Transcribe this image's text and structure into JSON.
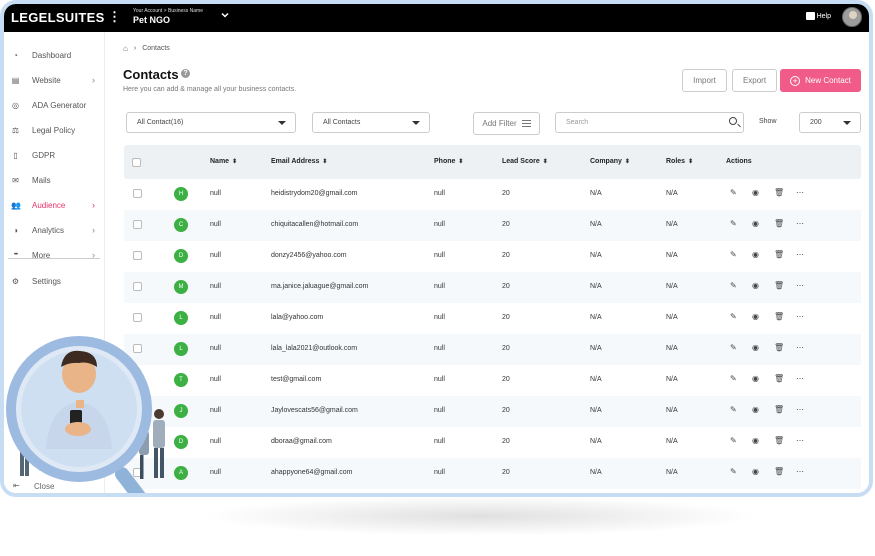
{
  "topbar": {
    "logo": "LEGELSUITES",
    "account_sub": "Your Account > Business Name",
    "account_name": "Pet NGO",
    "help_label": "Help"
  },
  "sidebar": {
    "items": [
      {
        "label": "Dashboard",
        "icon": "dashboard-icon",
        "chevron": false,
        "active": false
      },
      {
        "label": "Website",
        "icon": "website-icon",
        "chevron": true,
        "active": false
      },
      {
        "label": "ADA Generator",
        "icon": "ada-icon",
        "chevron": false,
        "active": false
      },
      {
        "label": "Legal Policy",
        "icon": "policy-icon",
        "chevron": false,
        "active": false
      },
      {
        "label": "GDPR",
        "icon": "gdpr-icon",
        "chevron": false,
        "active": false
      },
      {
        "label": "Mails",
        "icon": "mail-icon",
        "chevron": false,
        "active": false
      },
      {
        "label": "Audience",
        "icon": "audience-icon",
        "chevron": true,
        "active": true
      },
      {
        "label": "Analytics",
        "icon": "analytics-icon",
        "chevron": true,
        "active": false
      },
      {
        "label": "More",
        "icon": "more-icon",
        "chevron": true,
        "active": false
      },
      {
        "label": "Settings",
        "icon": "gear-icon",
        "chevron": false,
        "active": false
      }
    ],
    "close_label": "Close"
  },
  "breadcrumb": {
    "current": "Contacts"
  },
  "page": {
    "title": "Contacts",
    "subtitle": "Here you can add & manage all your business contacts.",
    "import_label": "Import",
    "export_label": "Export",
    "new_contact_label": "New Contact"
  },
  "filters": {
    "contact_select": "All Contact(16)",
    "list_select": "All Contacts",
    "add_filter_label": "Add Filter",
    "search_placeholder": "Search",
    "show_label": "Show",
    "show_value": "200"
  },
  "table": {
    "headers": {
      "name": "Name",
      "email": "Email Address",
      "phone": "Phone",
      "lead_score": "Lead Score",
      "company": "Company",
      "roles": "Roles",
      "actions": "Actions"
    },
    "rows": [
      {
        "initial": "H",
        "name": "null",
        "email": "heidistrydom20@gmail.com",
        "phone": "null",
        "lead_score": "20",
        "company": "N/A",
        "roles": "N/A"
      },
      {
        "initial": "C",
        "name": "null",
        "email": "chiquitacallen@hotmail.com",
        "phone": "null",
        "lead_score": "20",
        "company": "N/A",
        "roles": "N/A"
      },
      {
        "initial": "D",
        "name": "null",
        "email": "donzy2456@yahoo.com",
        "phone": "null",
        "lead_score": "20",
        "company": "N/A",
        "roles": "N/A"
      },
      {
        "initial": "M",
        "name": "null",
        "email": "ma.janice.jaluague@gmail.com",
        "phone": "null",
        "lead_score": "20",
        "company": "N/A",
        "roles": "N/A"
      },
      {
        "initial": "L",
        "name": "null",
        "email": "lala@yahoo.com",
        "phone": "null",
        "lead_score": "20",
        "company": "N/A",
        "roles": "N/A"
      },
      {
        "initial": "L",
        "name": "null",
        "email": "lala_lala2021@outlook.com",
        "phone": "null",
        "lead_score": "20",
        "company": "N/A",
        "roles": "N/A"
      },
      {
        "initial": "T",
        "name": "null",
        "email": "test@gmail.com",
        "phone": "null",
        "lead_score": "20",
        "company": "N/A",
        "roles": "N/A"
      },
      {
        "initial": "J",
        "name": "null",
        "email": "Jaylovescats56@gmail.com",
        "phone": "null",
        "lead_score": "20",
        "company": "N/A",
        "roles": "N/A"
      },
      {
        "initial": "D",
        "name": "null",
        "email": "dboraa@gmail.com",
        "phone": "null",
        "lead_score": "20",
        "company": "N/A",
        "roles": "N/A"
      },
      {
        "initial": "A",
        "name": "null",
        "email": "ahappyone64@gmail.com",
        "phone": "null",
        "lead_score": "20",
        "company": "N/A",
        "roles": "N/A"
      }
    ]
  },
  "colors": {
    "accent": "#f05b8a",
    "active_nav": "#e8336a",
    "avatar_badge": "#3cb043",
    "frame_border": "#c7ddf4"
  }
}
